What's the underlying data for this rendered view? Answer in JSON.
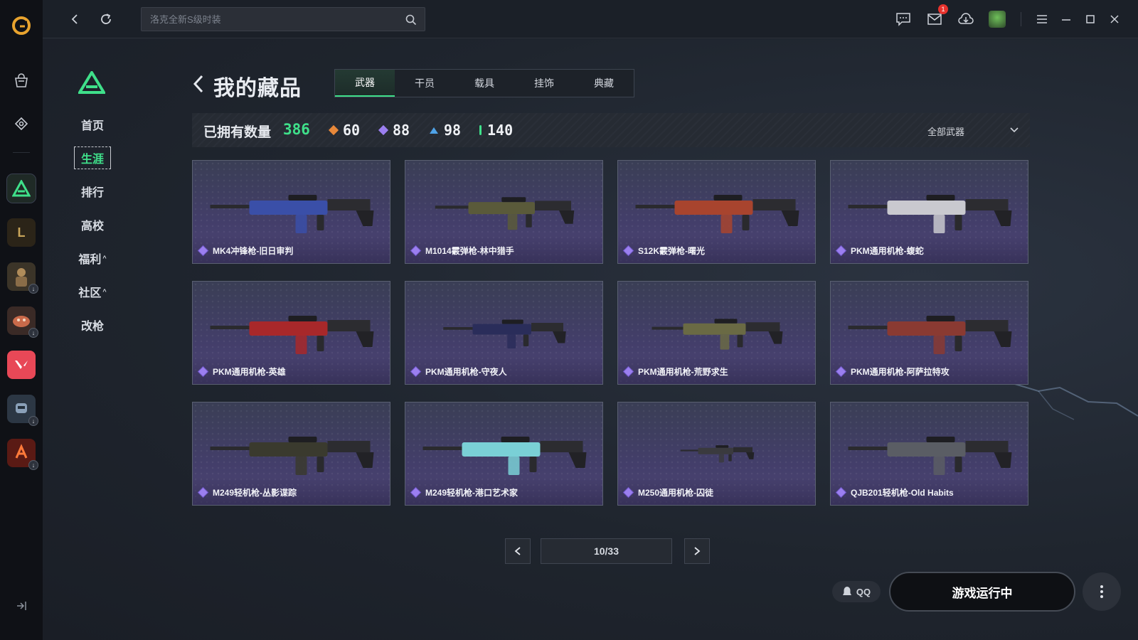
{
  "app": {
    "accent": "#3fe08a",
    "brand_color": "#e8a32e"
  },
  "topbar": {
    "search_placeholder": "洛克全新S级时装",
    "mail_badge": "1"
  },
  "rail": {
    "games": [
      {
        "name": "delta-force",
        "color": "#3fe08a"
      },
      {
        "name": "league-of-legends",
        "color": "#c9a55a"
      },
      {
        "name": "pubg",
        "color": "#b08c5a"
      },
      {
        "name": "monster-game",
        "color": "#c96a4a"
      },
      {
        "name": "valorant",
        "color": "#e84857"
      },
      {
        "name": "robot-game",
        "color": "#8aa0b8"
      },
      {
        "name": "martial-game",
        "color": "#d9432b"
      }
    ]
  },
  "sidebar": {
    "items": [
      {
        "label": "首页",
        "caret": ""
      },
      {
        "label": "生涯",
        "caret": ""
      },
      {
        "label": "排行",
        "caret": ""
      },
      {
        "label": "高校",
        "caret": ""
      },
      {
        "label": "福利",
        "caret": "^"
      },
      {
        "label": "社区",
        "caret": "^"
      },
      {
        "label": "改枪",
        "caret": ""
      }
    ]
  },
  "header": {
    "title": "我的藏品",
    "tabs": [
      {
        "label": "武器"
      },
      {
        "label": "干员"
      },
      {
        "label": "载具"
      },
      {
        "label": "挂饰"
      },
      {
        "label": "典藏"
      }
    ]
  },
  "stats": {
    "label": "已拥有数量",
    "total": "386",
    "rarities": [
      {
        "value": "60",
        "color": "#e8883a"
      },
      {
        "value": "88",
        "color": "#9b7ff0"
      },
      {
        "value": "98",
        "color": "#4fa3e8"
      },
      {
        "value": "140",
        "color": "#3fe08a"
      }
    ],
    "filter_label": "全部武器"
  },
  "items": [
    {
      "name": "MK4冲锋枪-旧日审判",
      "gun_color": "#3a4fa8"
    },
    {
      "name": "M1014霰弹枪-林中猎手",
      "gun_color": "#5a5a3a"
    },
    {
      "name": "S12K霰弹枪-曙光",
      "gun_color": "#a8442e"
    },
    {
      "name": "PKM通用机枪-蝮蛇",
      "gun_color": "#c9c9cf"
    },
    {
      "name": "PKM通用机枪-英雄",
      "gun_color": "#a8282a"
    },
    {
      "name": "PKM通用机枪-守夜人",
      "gun_color": "#2a2d5a"
    },
    {
      "name": "PKM通用机枪-荒野求生",
      "gun_color": "#6a6a44"
    },
    {
      "name": "PKM通用机枪-阿萨拉特攻",
      "gun_color": "#8a3a32"
    },
    {
      "name": "M249轻机枪-丛影谍踪",
      "gun_color": "#3a3a2e"
    },
    {
      "name": "M249轻机枪-港口艺术家",
      "gun_color": "#7ad0d6"
    },
    {
      "name": "M250通用机枪-囚徒",
      "gun_color": "#3a3a3e"
    },
    {
      "name": "QJB201轻机枪-Old Habits",
      "gun_color": "#5a5d64"
    }
  ],
  "pager": {
    "current": "10/33"
  },
  "footer": {
    "qq_label": "QQ",
    "run_label": "游戏运行中"
  }
}
